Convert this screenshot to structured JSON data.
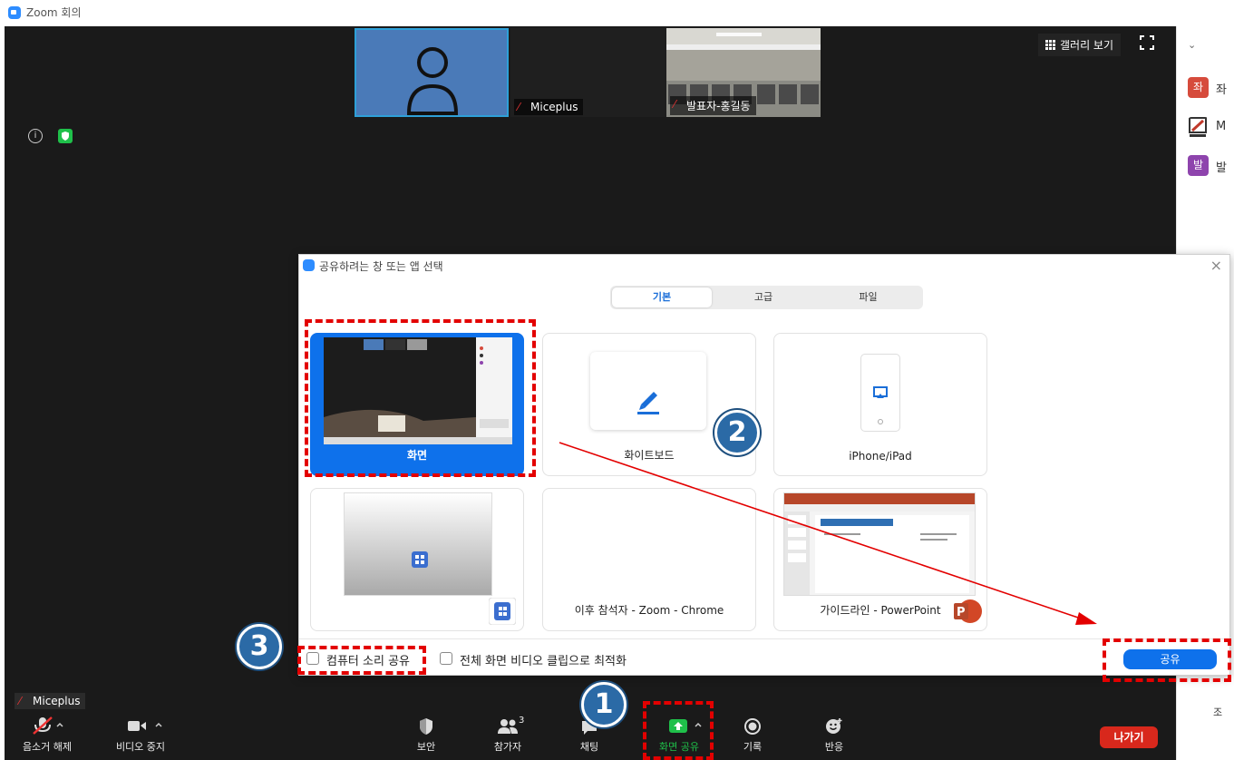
{
  "window": {
    "title": "Zoom 회의"
  },
  "video": {
    "tiles": [
      {
        "name": ""
      },
      {
        "name": "Miceplus"
      },
      {
        "name": "발표자-홍길동"
      }
    ],
    "gallery_label": "갤러리 보기"
  },
  "participants_panel": {
    "items": [
      {
        "avatar": "좌",
        "color": "#d64b3c",
        "name": "좌"
      },
      {
        "avatar": "",
        "color": "#444444",
        "name": "M"
      },
      {
        "avatar": "발",
        "color": "#8e44ad",
        "name": "발"
      }
    ],
    "bottom_label": "조"
  },
  "share_dialog": {
    "title": "공유하려는 창 또는 앱 선택",
    "tabs": [
      "기본",
      "고급",
      "파일"
    ],
    "tiles": {
      "screen": "화면",
      "whiteboard": "화이트보드",
      "iphone": "iPhone/iPad",
      "app1": "",
      "chrome": "이후 참석자 - Zoom - Chrome",
      "ppt": "가이드라인 - PowerPoint"
    },
    "share_sound_label": "컴퓨터 소리 공유",
    "optimize_label": "전체 화면 비디오 클립으로 최적화",
    "share_button": "공유"
  },
  "presenter_label": "Miceplus",
  "toolbar": {
    "unmute": "음소거 해제",
    "stop_video": "비디오 중지",
    "security": "보안",
    "participants": "참가자",
    "participants_count": "3",
    "chat": "채팅",
    "share_screen": "화면 공유",
    "record": "기록",
    "reactions": "반응",
    "leave": "나가기"
  },
  "annotations": {
    "step1": "1",
    "step2": "2",
    "step3": "3"
  },
  "colors": {
    "accent": "#0e71eb",
    "share_green": "#1fc04a",
    "leave_red": "#d8281c",
    "annotation_red": "#e30000"
  }
}
